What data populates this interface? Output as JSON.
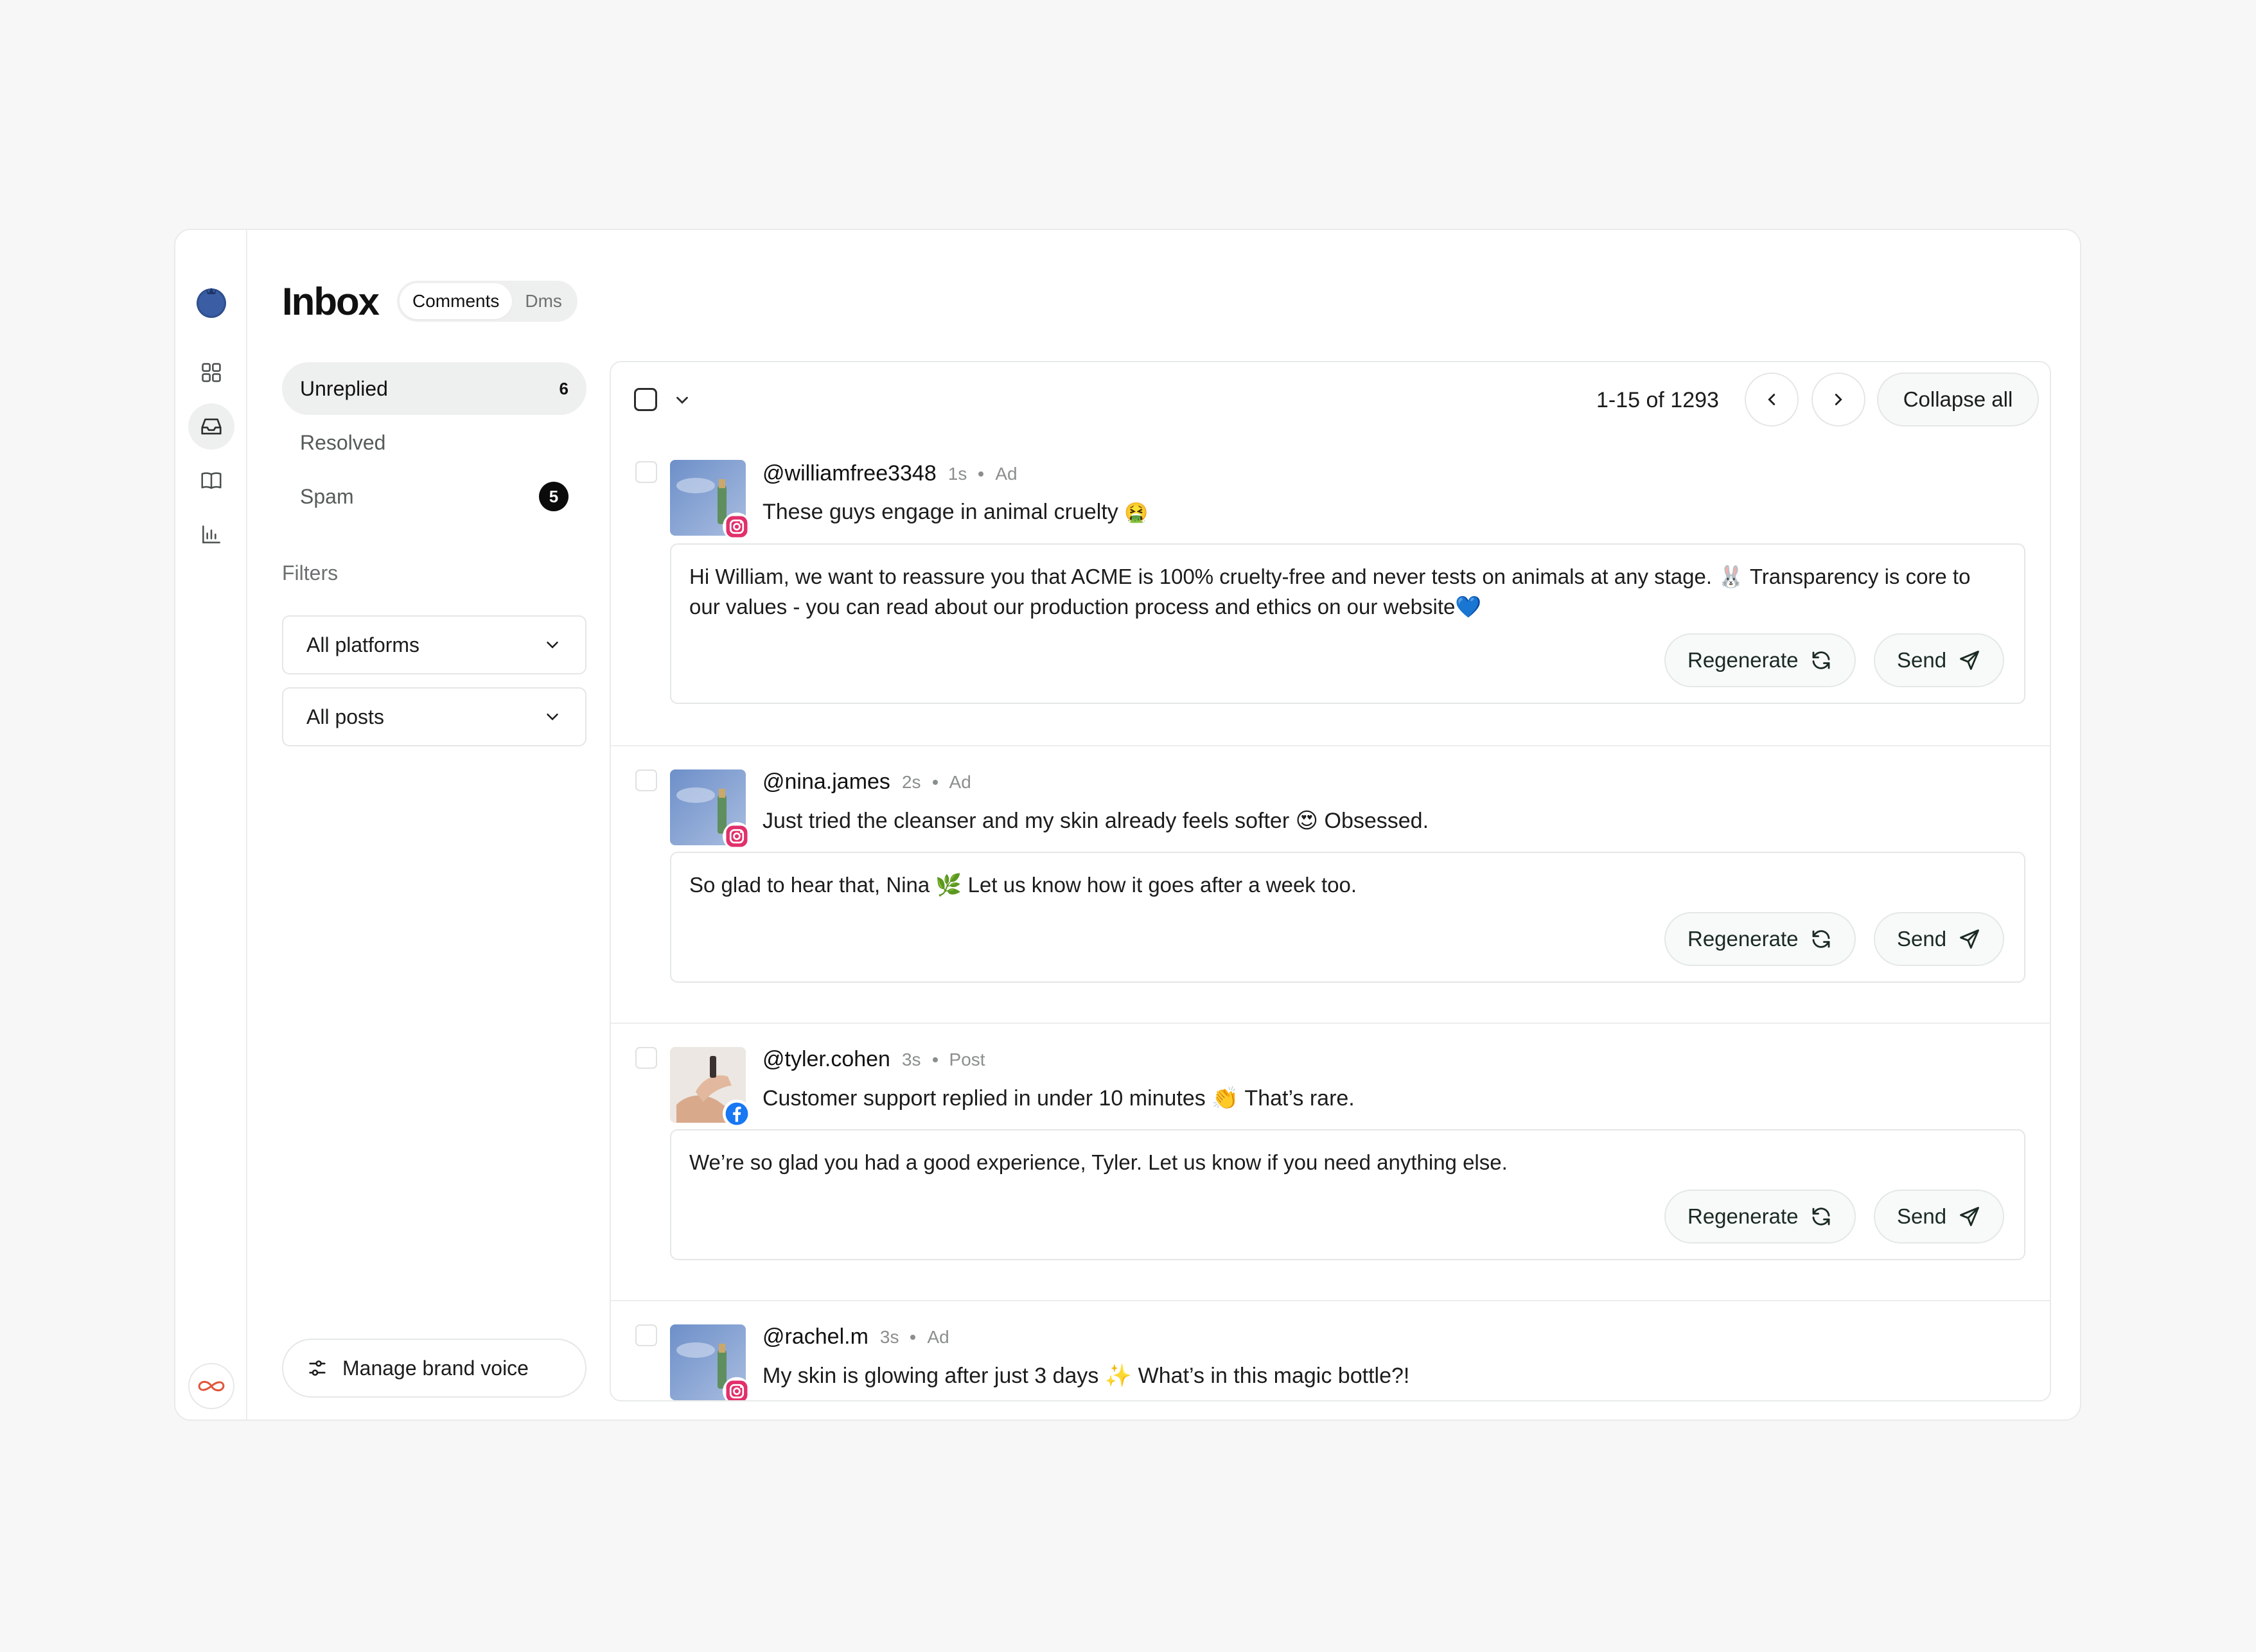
{
  "header": {
    "title": "Inbox",
    "tabs": [
      {
        "label": "Comments",
        "active": true
      },
      {
        "label": "Dms",
        "active": false
      }
    ]
  },
  "sidebar": {
    "nav_icons": [
      "grid-icon",
      "inbox-icon",
      "book-icon",
      "chart-icon"
    ],
    "active_nav": "inbox-icon"
  },
  "folders": [
    {
      "label": "Unreplied",
      "count": "6",
      "active": true
    },
    {
      "label": "Resolved",
      "count": "",
      "active": false
    },
    {
      "label": "Spam",
      "count": "5",
      "active": false
    }
  ],
  "filters": {
    "label": "Filters",
    "platform": "All platforms",
    "posts": "All posts"
  },
  "brand_voice_label": "Manage brand voice",
  "toolbar": {
    "range": "1-15 of 1293",
    "collapse_label": "Collapse all"
  },
  "actions": {
    "regenerate": "Regenerate",
    "send": "Send"
  },
  "comments": [
    {
      "handle": "@williamfree3348",
      "time": "1s",
      "kind": "Ad",
      "platform": "instagram",
      "text": "These guys engage in animal cruelty",
      "emoji": "🤮",
      "reply": "Hi William, we want to reassure you that ACME is 100% cruelty-free and never tests on animals at any stage. 🐰 Transparency is core to our values - you can read about our production process and ethics on our website💙"
    },
    {
      "handle": "@nina.james",
      "time": "2s",
      "kind": "Ad",
      "platform": "instagram",
      "text": "Just tried the cleanser and my skin already feels softer 😍 Obsessed.",
      "emoji": "",
      "reply": "So glad to hear that, Nina 🌿 Let us know how it goes after a week too."
    },
    {
      "handle": "@tyler.cohen",
      "time": "3s",
      "kind": "Post",
      "platform": "facebook",
      "text": "Customer support replied in under 10 minutes 👏 That’s rare.",
      "emoji": "",
      "reply": "We’re so glad you had a good experience, Tyler. Let us know if you need anything else."
    },
    {
      "handle": "@rachel.m",
      "time": "3s",
      "kind": "Ad",
      "platform": "instagram",
      "text": "My skin is glowing after just 3 days ✨ What’s in this magic bottle?!",
      "emoji": "",
      "reply": ""
    }
  ],
  "colors": {
    "accent_logo": "#2f4f8f",
    "instagram": "#e1306c",
    "facebook": "#1877f2",
    "badge_bg": "#0b0b0b"
  }
}
